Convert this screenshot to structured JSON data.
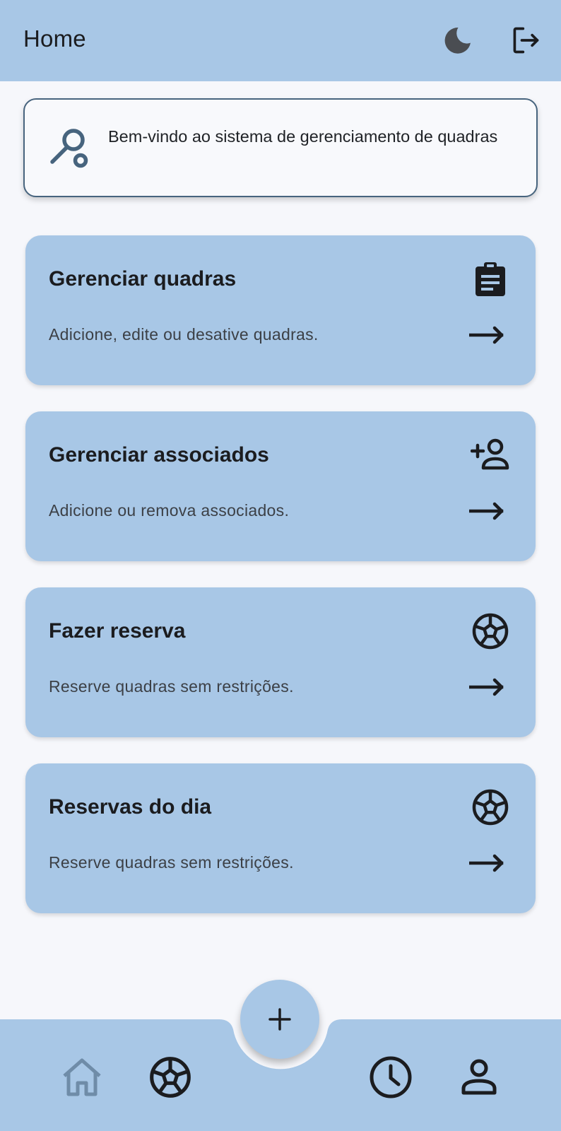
{
  "appbar": {
    "title": "Home",
    "theme_icon": "moon-icon",
    "logout_icon": "logout-icon"
  },
  "welcome": {
    "icon": "tennis-racket-icon",
    "text": "Bem-vindo ao sistema de gerenciamento de quadras"
  },
  "cards": [
    {
      "title": "Gerenciar quadras",
      "description": "Adicione, edite ou desative quadras.",
      "icon": "clipboard-icon"
    },
    {
      "title": "Gerenciar associados",
      "description": "Adicione ou remova associados.",
      "icon": "add-person-icon"
    },
    {
      "title": "Fazer reserva",
      "description": "Reserve quadras sem restrições.",
      "icon": "soccer-ball-icon"
    },
    {
      "title": "Reservas do dia",
      "description": "Reserve quadras sem restrições.",
      "icon": "soccer-ball-icon"
    }
  ],
  "fab": {
    "icon": "plus-icon"
  },
  "bottom_nav": {
    "items": [
      {
        "icon": "home-icon",
        "active": true
      },
      {
        "icon": "soccer-ball-icon",
        "active": false
      },
      {
        "icon": "clock-icon",
        "active": false
      },
      {
        "icon": "person-icon",
        "active": false
      }
    ]
  },
  "colors": {
    "primary": "#a8c7e6",
    "background": "#f6f7fb",
    "banner_border": "#47647e",
    "text": "#1b1c1f",
    "active_nav_icon": "#6f8ca8"
  }
}
